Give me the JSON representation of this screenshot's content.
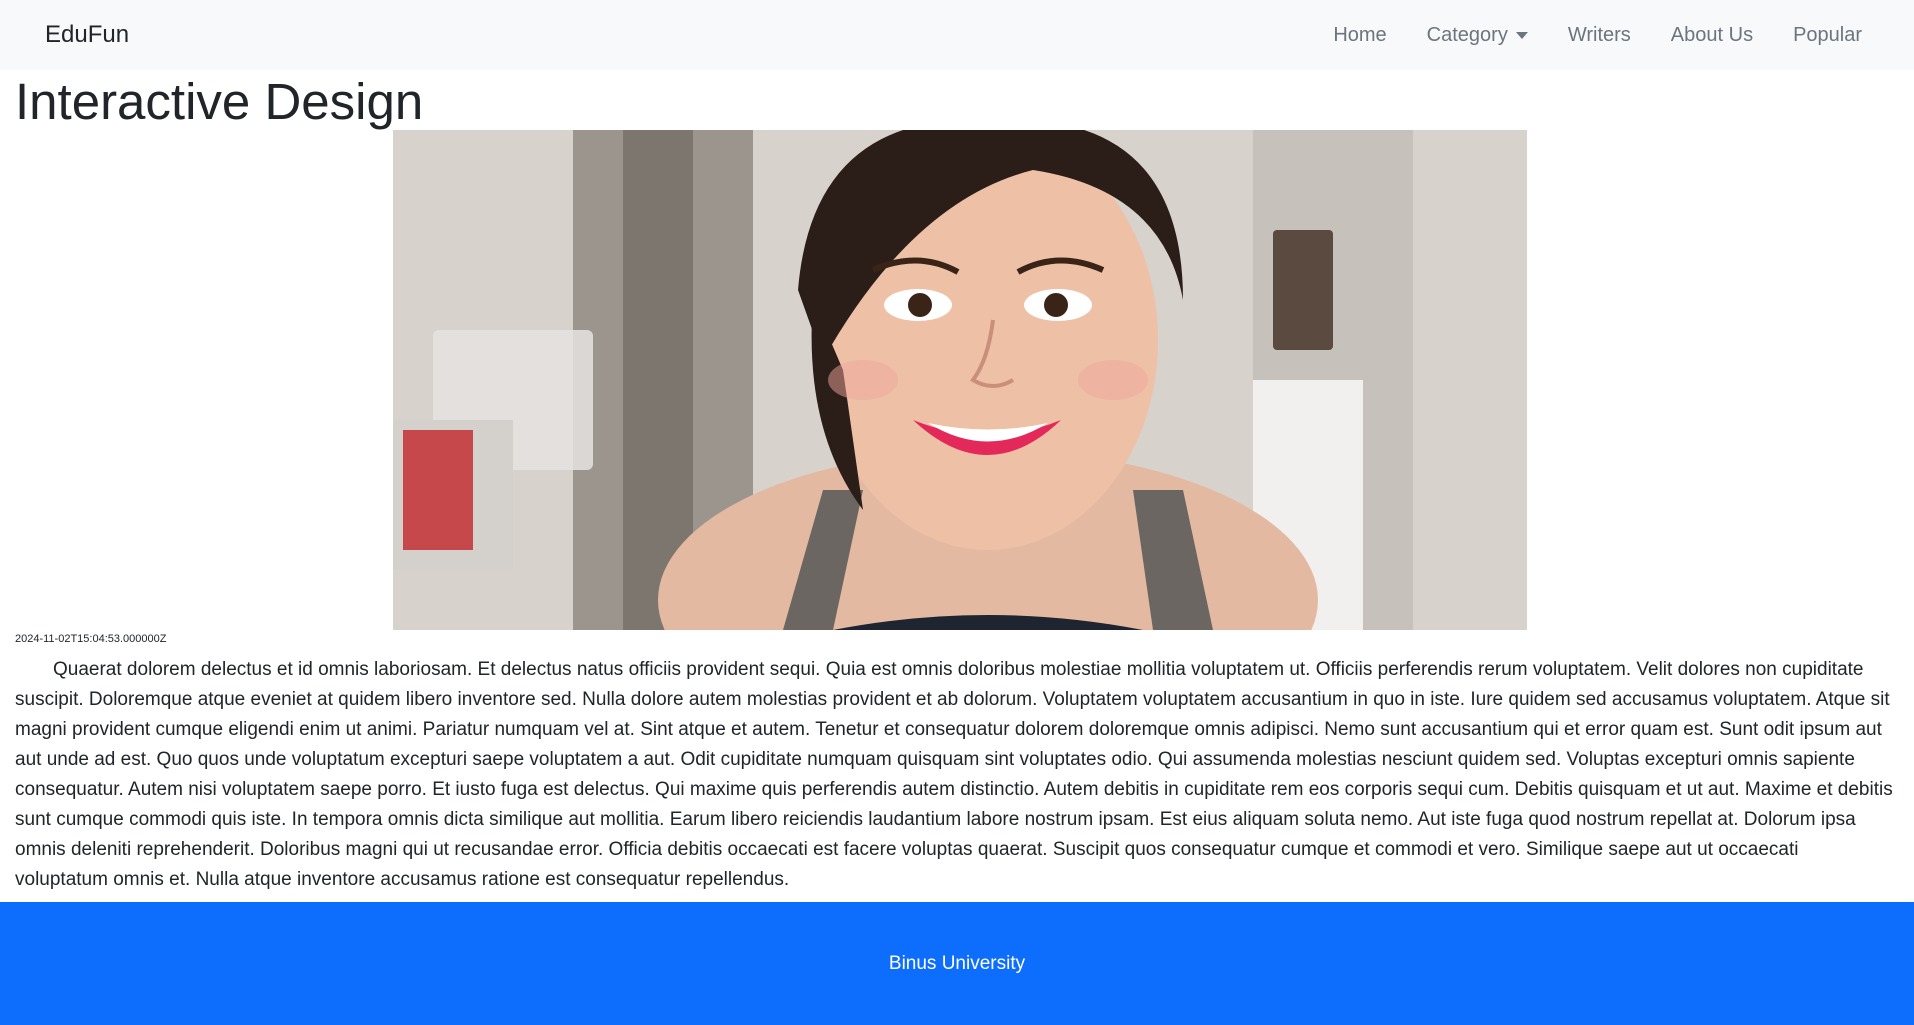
{
  "navbar": {
    "brand": "EduFun",
    "links": [
      {
        "label": "Home"
      },
      {
        "label": "Category"
      },
      {
        "label": "Writers"
      },
      {
        "label": "About Us"
      },
      {
        "label": "Popular"
      }
    ]
  },
  "article": {
    "title": "Interactive Design",
    "timestamp": "2024-11-02T15:04:53.000000Z",
    "body": "Quaerat dolorem delectus et id omnis laboriosam. Et delectus natus officiis provident sequi. Quia est omnis doloribus molestiae mollitia voluptatem ut. Officiis perferendis rerum voluptatem. Velit dolores non cupiditate suscipit. Doloremque atque eveniet at quidem libero inventore sed. Nulla dolore autem molestias provident et ab dolorum. Voluptatem voluptatem accusantium in quo in iste. Iure quidem sed accusamus voluptatem. Atque sit magni provident cumque eligendi enim ut animi. Pariatur numquam vel at. Sint atque et autem. Tenetur et consequatur dolorem doloremque omnis adipisci. Nemo sunt accusantium qui et error quam est. Sunt odit ipsum aut aut unde ad est. Quo quos unde voluptatum excepturi saepe voluptatem a aut. Odit cupiditate numquam quisquam sint voluptates odio. Qui assumenda molestias nesciunt quidem sed. Voluptas excepturi omnis sapiente consequatur. Autem nisi voluptatem saepe porro. Et iusto fuga est delectus. Qui maxime quis perferendis autem distinctio. Autem debitis in cupiditate rem eos corporis sequi cum. Debitis quisquam et ut aut. Maxime et debitis sunt cumque commodi quis iste. In tempora omnis dicta similique aut mollitia. Earum libero reiciendis laudantium labore nostrum ipsam. Est eius aliquam soluta nemo. Aut iste fuga quod nostrum repellat at. Dolorum ipsa omnis deleniti reprehenderit. Doloribus magni qui ut recusandae error. Officia debitis occaecati est facere voluptas quaerat. Suscipit quos consequatur cumque et commodi et vero. Similique saepe aut ut occaecati voluptatum omnis et. Nulla atque inventore accusamus ratione est consequatur repellendus."
  },
  "footer": {
    "text": "Binus University",
    "color": "#0d6efd"
  }
}
